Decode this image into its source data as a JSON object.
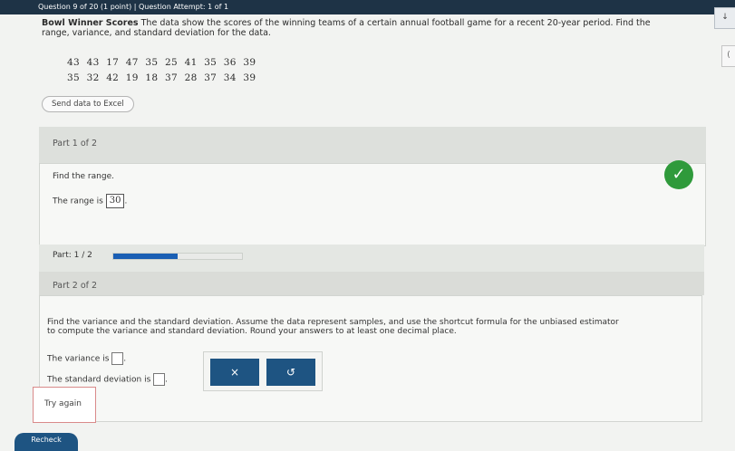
{
  "header": {
    "question_info": "Question 9 of 20 (1 point)  |  Question Attempt: 1 of 1"
  },
  "corner_button": "↓",
  "corner_button2": "(",
  "problem": {
    "title": "Bowl Winner Scores",
    "text_line1": "The data show the scores of the winning teams of a certain annual football game for a recent 20-year period. Find the",
    "text_line2": "range, variance, and standard deviation for the data.",
    "data_row1": "43 43 17 47 35 25 41 35 36 39",
    "data_row2": "35 32 42 19 18 37 28 37 34 39"
  },
  "excel_button": "Send data to Excel",
  "part1": {
    "label": "Part 1 of 2",
    "prompt": "Find the range.",
    "answer_prefix": "The range is",
    "answer_value": "30",
    "answer_suffix": ".",
    "check_icon": "✓"
  },
  "progress": {
    "label": "Part: 1 / 2",
    "fraction": 0.5
  },
  "part2": {
    "label": "Part 2 of 2",
    "instr_line1": "Find the variance and the standard deviation. Assume the data represent samples, and use the shortcut formula for the unbiased estimator",
    "instr_line2": "to compute the variance and standard deviation. Round your answers to at least one decimal place.",
    "variance_label": "The variance is",
    "stddev_label": "The standard deviation is",
    "period": "."
  },
  "tools": {
    "clear_label": "×",
    "undo_label": "↺"
  },
  "try_again_label": "Try again",
  "recheck_label": "Recheck",
  "colors": {
    "accent": "#1e5482",
    "check": "#2f9a3b",
    "progress": "#1a5fb4"
  }
}
